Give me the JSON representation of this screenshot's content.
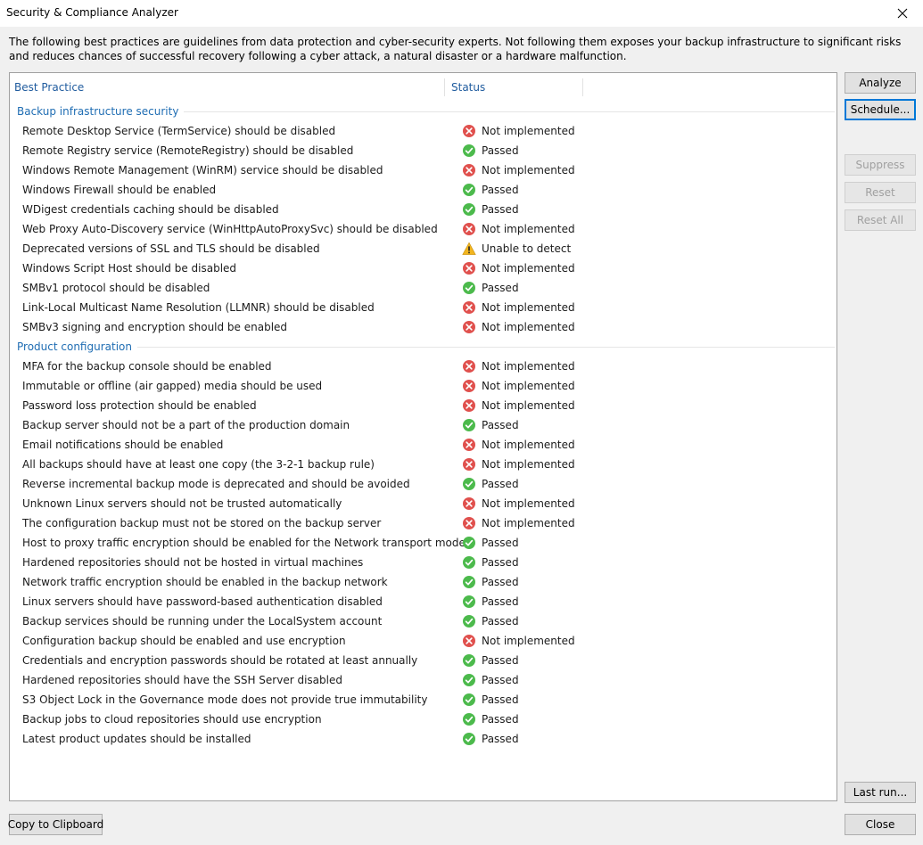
{
  "window": {
    "title": "Security & Compliance Analyzer"
  },
  "description": "The following best practices are guidelines from data protection and cyber-security experts. Not following them exposes your backup infrastructure to significant risks and reduces chances of successful recovery following a cyber attack, a natural disaster or a hardware malfunction.",
  "table": {
    "columns": [
      "Best Practice",
      "Status"
    ],
    "groups": [
      {
        "name": "Backup infrastructure security",
        "rows": [
          {
            "practice": "Remote Desktop Service (TermService) should be disabled",
            "status": "Not implemented",
            "icon": "error-icon"
          },
          {
            "practice": "Remote Registry service (RemoteRegistry) should be disabled",
            "status": "Passed",
            "icon": "passed-icon"
          },
          {
            "practice": "Windows Remote Management (WinRM) service should be disabled",
            "status": "Not implemented",
            "icon": "error-icon"
          },
          {
            "practice": "Windows Firewall should be enabled",
            "status": "Passed",
            "icon": "passed-icon"
          },
          {
            "practice": "WDigest credentials caching should be disabled",
            "status": "Passed",
            "icon": "passed-icon"
          },
          {
            "practice": "Web Proxy Auto-Discovery service (WinHttpAutoProxySvc) should be disabled",
            "status": "Not implemented",
            "icon": "error-icon"
          },
          {
            "practice": "Deprecated versions of SSL and TLS should be disabled",
            "status": "Unable to detect",
            "icon": "warning-icon"
          },
          {
            "practice": "Windows Script Host should be disabled",
            "status": "Not implemented",
            "icon": "error-icon"
          },
          {
            "practice": "SMBv1 protocol should be disabled",
            "status": "Passed",
            "icon": "passed-icon"
          },
          {
            "practice": "Link-Local Multicast Name Resolution (LLMNR) should be disabled",
            "status": "Not implemented",
            "icon": "error-icon"
          },
          {
            "practice": "SMBv3 signing and encryption should be enabled",
            "status": "Not implemented",
            "icon": "error-icon"
          }
        ]
      },
      {
        "name": "Product configuration",
        "rows": [
          {
            "practice": "MFA for the backup console should be enabled",
            "status": "Not implemented",
            "icon": "error-icon"
          },
          {
            "practice": "Immutable or offline (air gapped) media should be used",
            "status": "Not implemented",
            "icon": "error-icon"
          },
          {
            "practice": "Password loss protection should be enabled",
            "status": "Not implemented",
            "icon": "error-icon"
          },
          {
            "practice": "Backup server should not be a part of the production domain",
            "status": "Passed",
            "icon": "passed-icon"
          },
          {
            "practice": "Email notifications should be enabled",
            "status": "Not implemented",
            "icon": "error-icon"
          },
          {
            "practice": "All backups should have at least one copy (the 3-2-1 backup rule)",
            "status": "Not implemented",
            "icon": "error-icon"
          },
          {
            "practice": "Reverse incremental backup mode is deprecated and should be avoided",
            "status": "Passed",
            "icon": "passed-icon"
          },
          {
            "practice": "Unknown Linux servers should not be trusted automatically",
            "status": "Not implemented",
            "icon": "error-icon"
          },
          {
            "practice": "The configuration backup must not be stored on the backup server",
            "status": "Not implemented",
            "icon": "error-icon"
          },
          {
            "practice": "Host to proxy traffic encryption should be enabled for the Network transport mode",
            "status": "Passed",
            "icon": "passed-icon"
          },
          {
            "practice": "Hardened repositories should not be hosted in virtual machines",
            "status": "Passed",
            "icon": "passed-icon"
          },
          {
            "practice": "Network traffic encryption should be enabled in the backup network",
            "status": "Passed",
            "icon": "passed-icon"
          },
          {
            "practice": "Linux servers should have password-based authentication disabled",
            "status": "Passed",
            "icon": "passed-icon"
          },
          {
            "practice": "Backup services should be running under the LocalSystem account",
            "status": "Passed",
            "icon": "passed-icon"
          },
          {
            "practice": "Configuration backup should be enabled and use encryption",
            "status": "Not implemented",
            "icon": "error-icon"
          },
          {
            "practice": "Credentials and encryption passwords should be rotated at least annually",
            "status": "Passed",
            "icon": "passed-icon"
          },
          {
            "practice": "Hardened repositories should have the SSH Server disabled",
            "status": "Passed",
            "icon": "passed-icon"
          },
          {
            "practice": "S3 Object Lock in the Governance mode does not provide true immutability",
            "status": "Passed",
            "icon": "passed-icon"
          },
          {
            "practice": "Backup jobs to cloud repositories should use encryption",
            "status": "Passed",
            "icon": "passed-icon"
          },
          {
            "practice": "Latest product updates should be installed",
            "status": "Passed",
            "icon": "passed-icon"
          }
        ]
      }
    ]
  },
  "buttons": {
    "analyze": "Analyze",
    "schedule": "Schedule...",
    "suppress": "Suppress",
    "reset": "Reset",
    "reset_all": "Reset All",
    "last_run": "Last run...",
    "copy": "Copy to Clipboard",
    "close": "Close"
  },
  "colors": {
    "error": "#e0504d",
    "passed": "#4cba4c",
    "warning": "#f2b51f",
    "header_text": "#1f5b9e",
    "focus": "#0078d7"
  }
}
